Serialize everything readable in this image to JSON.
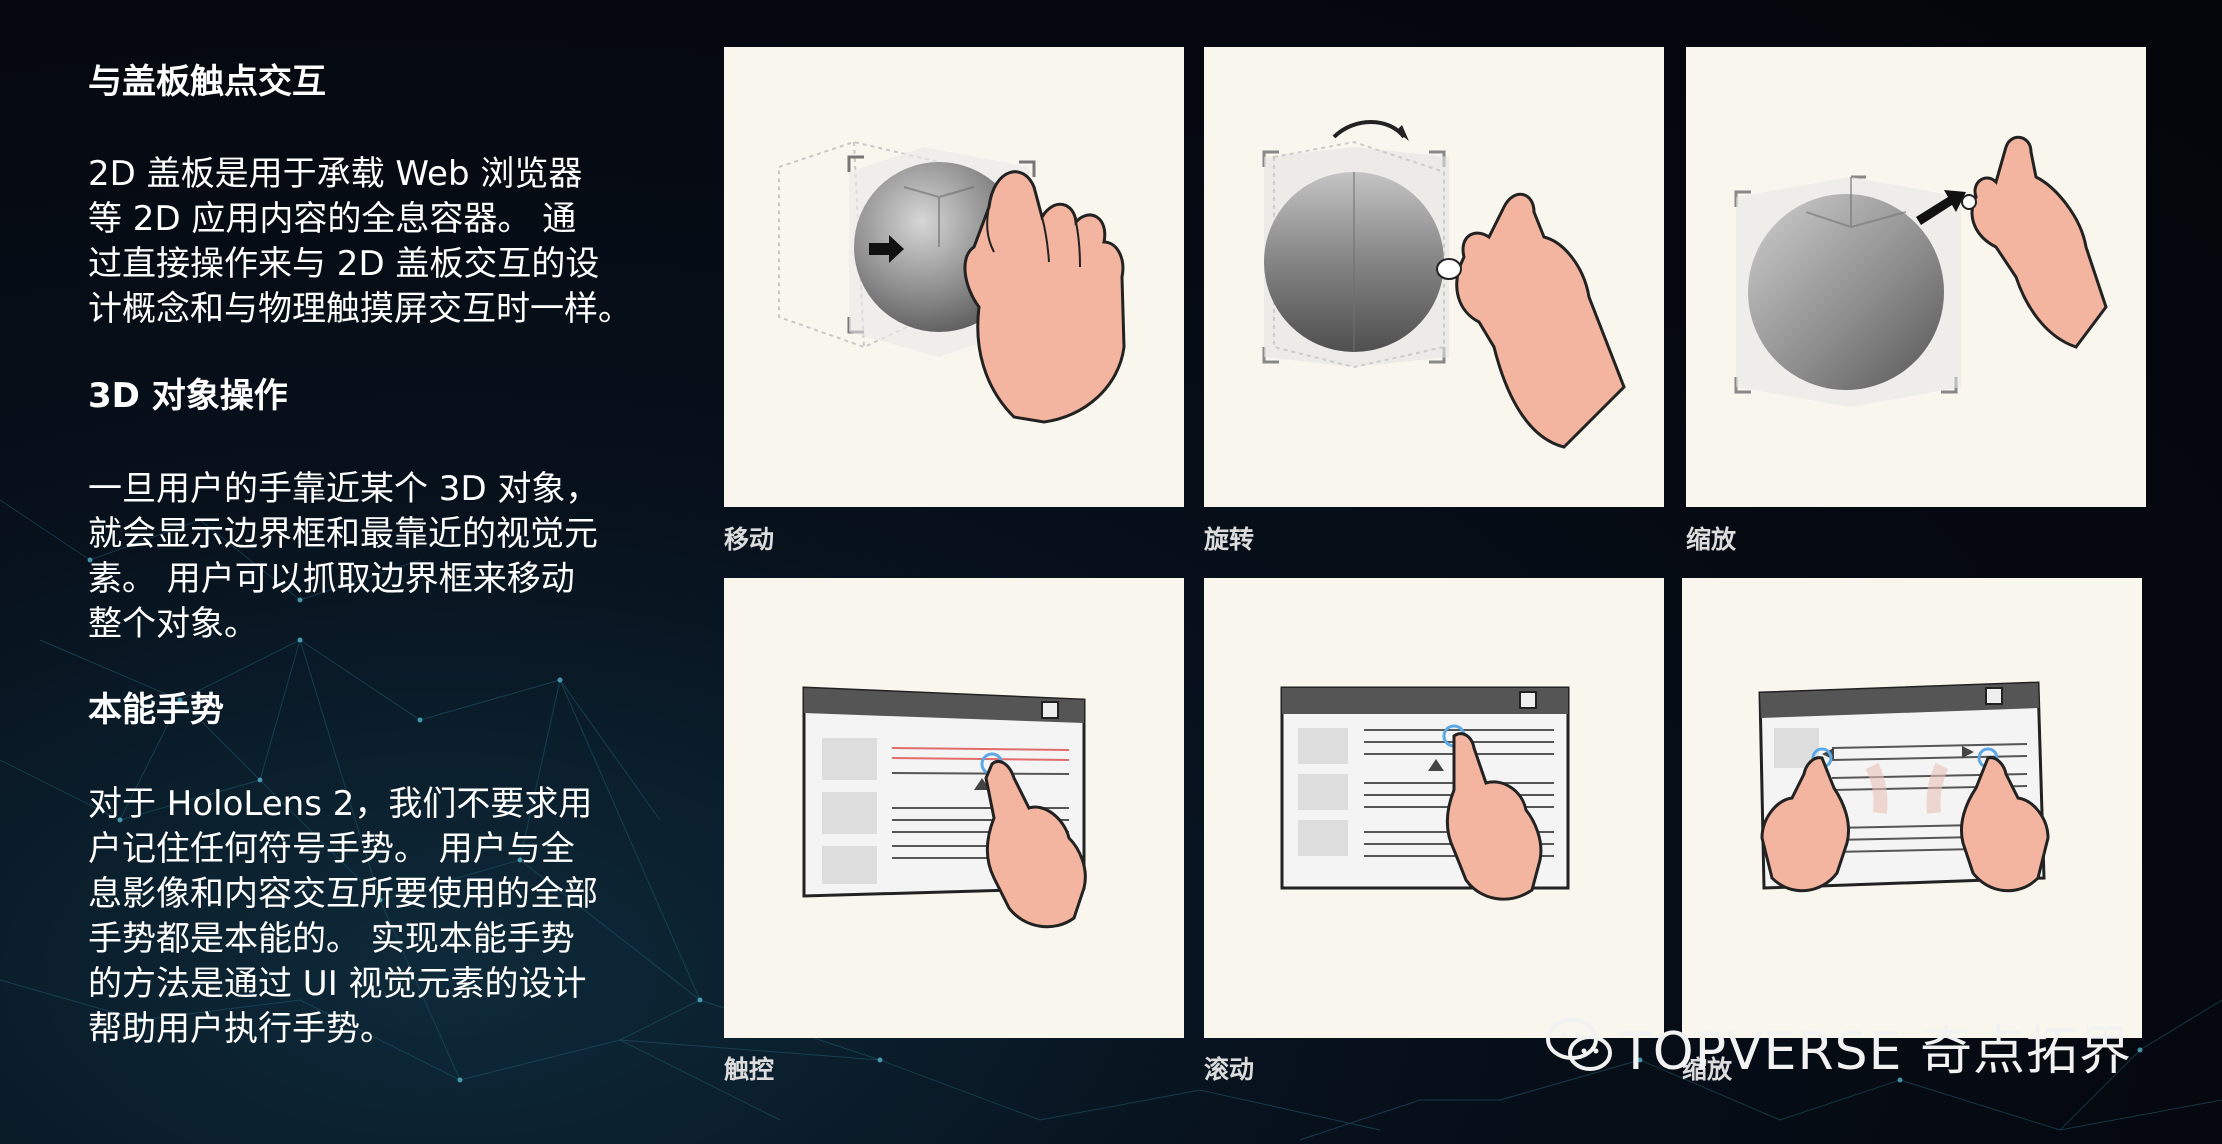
{
  "sections": [
    {
      "title": "与盖板触点交互",
      "lines": [
        "2D 盖板是用于承载 Web 浏览器",
        "等 2D 应用内容的全息容器。 通",
        "过直接操作来与 2D 盖板交互的设",
        "计概念和与物理触摸屏交互时一样。"
      ]
    },
    {
      "title": "3D 对象操作",
      "lines": [
        "一旦用户的手靠近某个 3D 对象，",
        "就会显示边界框和最靠近的视觉元",
        "素。 用户可以抓取边界框来移动",
        "整个对象。"
      ]
    },
    {
      "title": "本能手势",
      "lines": [
        "对于 HoloLens 2，我们不要求用",
        "户记住任何符号手势。 用户与全",
        "息影像和内容交互所要使用的全部",
        "手势都是本能的。 实现本能手势",
        "的方法是通过 UI 视觉元素的设计",
        "帮助用户执行手势。"
      ]
    }
  ],
  "panels": {
    "move": {
      "caption": "移动"
    },
    "rotate": {
      "caption": "旋转"
    },
    "scale3d": {
      "caption": "缩放"
    },
    "touch": {
      "caption": "触控"
    },
    "scroll": {
      "caption": "滚动"
    },
    "zoom2d": {
      "caption": "缩放"
    }
  },
  "watermark": {
    "text": "TOPVERSE 奇点拓界"
  },
  "colors": {
    "panel_bg": "#f9f6ee",
    "hand": "#f3b4a0",
    "accent_blue": "#5aa8e6",
    "accent_red": "#e06c6c"
  }
}
